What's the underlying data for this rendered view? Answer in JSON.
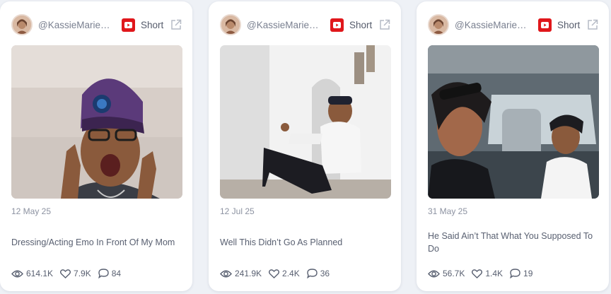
{
  "cards": [
    {
      "handle": "@KassieMarieC...",
      "platform": "Short",
      "date": "12 May 25",
      "title": "Dressing/Acting Emo In Front Of My Mom",
      "views": "614.1K",
      "likes": "7.9K",
      "comments": "84"
    },
    {
      "handle": "@KassieMarieC...",
      "platform": "Short",
      "date": "12 Jul 25",
      "title": "Well This Didn’t Go As Planned",
      "views": "241.9K",
      "likes": "2.4K",
      "comments": "36"
    },
    {
      "handle": "@KassieMarieC...",
      "platform": "Short",
      "date": "31 May 25",
      "title": "He Said Ain’t That What You Supposed To Do",
      "views": "56.7K",
      "likes": "1.4K",
      "comments": "19"
    }
  ],
  "icons": {
    "platform": "youtube-icon",
    "external": "external-link-icon",
    "views": "eye-icon",
    "likes": "heart-icon",
    "comments": "comment-icon"
  },
  "colors": {
    "youtube_red": "#e0171b",
    "card_bg": "#ffffff",
    "page_bg": "#eef1f6"
  }
}
